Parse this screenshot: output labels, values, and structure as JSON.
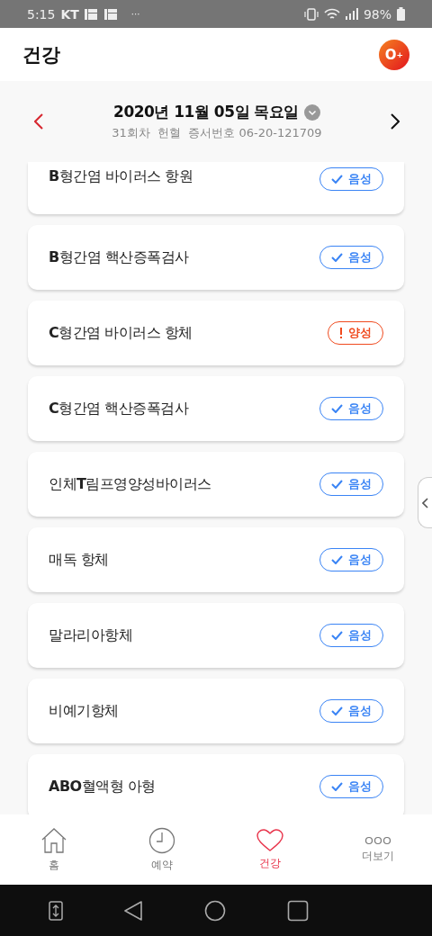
{
  "status_bar": {
    "time": "5:15",
    "carrier": "KT",
    "more": "···",
    "battery": "98%"
  },
  "header": {
    "title": "건강",
    "blood_type": "O$^{+}$"
  },
  "date_nav": {
    "date": "2020년 11월 05일 목요일",
    "subtitle": "31회차  헌혈  증서번호 06-20-121709"
  },
  "tests": [
    {
      "name": "**B**형간염 바이러스 항원",
      "kind": "negative",
      "result": "음성"
    },
    {
      "name": "**B**형간염 핵산증폭검사",
      "kind": "negative",
      "result": "음성"
    },
    {
      "name": "**C**형간염 바이러스 항체",
      "kind": "positive",
      "result": "양성"
    },
    {
      "name": "**C**형간염 핵산증폭검사",
      "kind": "negative",
      "result": "음성"
    },
    {
      "name": "인체**T**림프영양성바이러스",
      "kind": "negative",
      "result": "음성"
    },
    {
      "name": "매독 항체",
      "kind": "negative",
      "result": "음성"
    },
    {
      "name": "말라리아항체",
      "kind": "negative",
      "result": "음성"
    },
    {
      "name": "비예기항체",
      "kind": "negative",
      "result": "음성"
    },
    {
      "name": "**ABO**혈액형 아형",
      "kind": "negative",
      "result": "음성"
    }
  ],
  "nav": [
    {
      "kind": "home",
      "label": "홈",
      "selected": false
    },
    {
      "kind": "clock",
      "label": "예약",
      "selected": false
    },
    {
      "kind": "heart",
      "label": "건강",
      "selected": true
    },
    {
      "kind": "more",
      "label": "더보기",
      "selected": false
    }
  ]
}
